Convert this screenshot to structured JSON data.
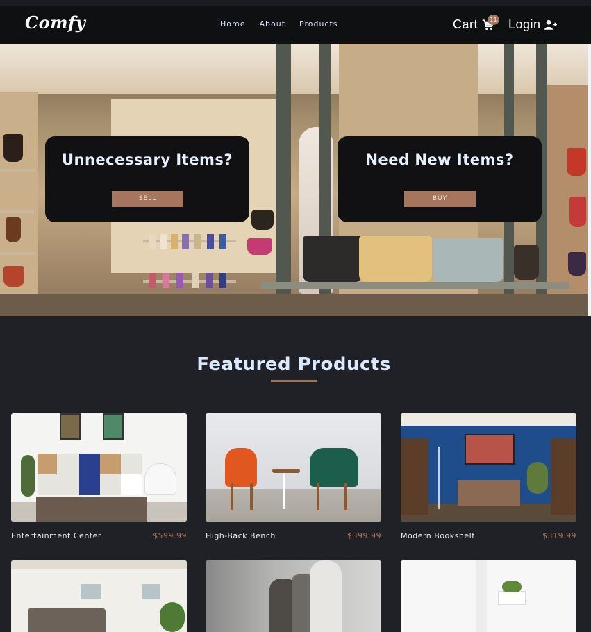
{
  "nav": {
    "logo": "Comfy",
    "links": [
      "Home",
      "About",
      "Products"
    ],
    "cart_label": "Cart",
    "cart_count": "11",
    "login_label": "Login"
  },
  "hero": {
    "sell_card": {
      "title": "Unnecessary Items?",
      "button": "SELL"
    },
    "buy_card": {
      "title": "Need New Items?",
      "button": "BUY"
    }
  },
  "featured": {
    "title": "Featured Products",
    "products": [
      {
        "name": "Entertainment Center",
        "price": "$599.99"
      },
      {
        "name": "High-Back Bench",
        "price": "$399.99"
      },
      {
        "name": "Modern Bookshelf",
        "price": "$319.99"
      }
    ]
  },
  "colors": {
    "accent": "#a5755d",
    "background": "#202126",
    "navbar": "#0f1012",
    "heading": "#dbe9ff"
  },
  "icons": {
    "cart": "shopping-cart-icon",
    "login": "user-plus-icon"
  }
}
